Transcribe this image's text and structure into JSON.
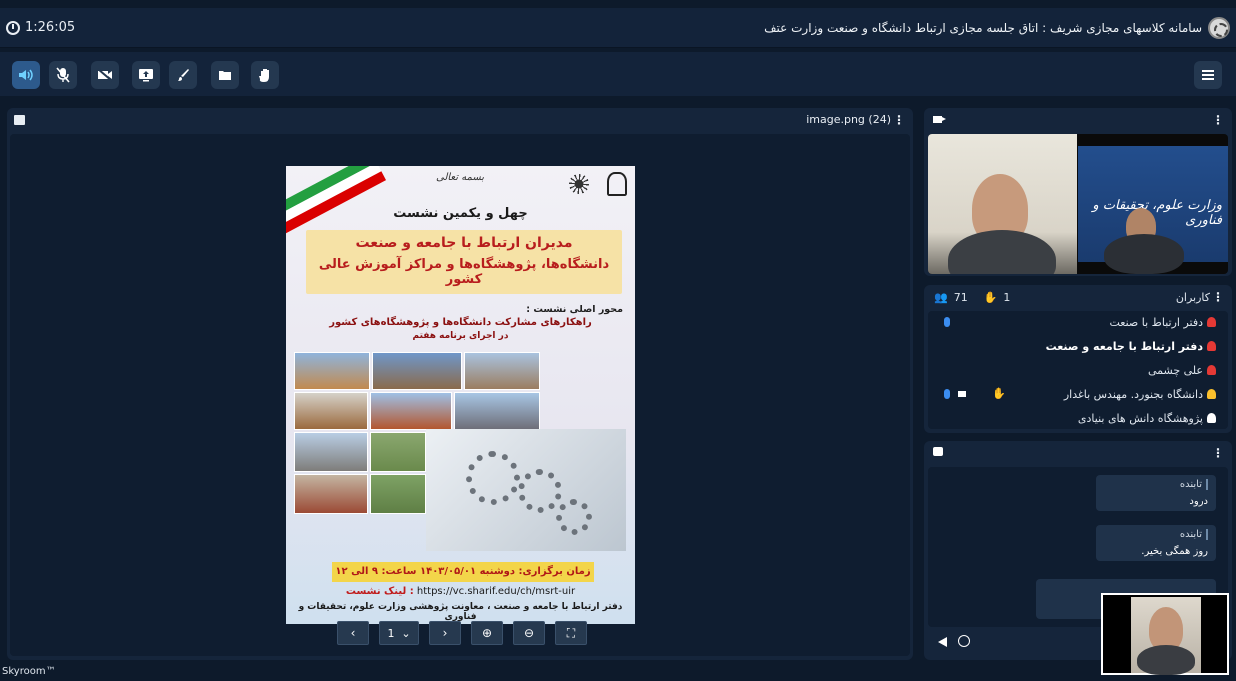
{
  "header": {
    "timer": "1:26:05",
    "title": "سامانه کلاسهای مجازی شریف : اتاق جلسه مجازی ارتباط دانشگاه و صنعت وزارت عتف"
  },
  "toolbar": {
    "buttons": [
      "speaker-icon",
      "mic-off-icon",
      "camera-off-icon",
      "share-screen-icon",
      "brush-icon",
      "folder-icon",
      "raise-hand-icon"
    ],
    "menu": "menu-icon"
  },
  "stage": {
    "file_name": "image.png (24)",
    "page_number": "1",
    "poster": {
      "bism": "بسمه تعالی",
      "heading": "چهل و یکمین نشست",
      "banner_line1": "مدیران ارتباط با جامعه و صنعت",
      "banner_line2": "دانشگاه‌ها، پژوهشگاه‌ها و مراکز آموزش عالی کشور",
      "axis_label": "محور اصلی نشست :",
      "axis_text1": "راهکارهای مشارکت دانشگاه‌ها و پژوهشگاه‌های کشور",
      "axis_text2": "در اجرای برنامه هفتم",
      "date": "زمان برگزاری: دوشنبه ۱۴۰۳/۰۵/۰۱ ساعت: ۹ الی ۱۲",
      "link_label": "لینک نشست :",
      "link_url": "https://vc.sharif.edu/ch/msrt-uir",
      "footer": "دفتر ارتباط با جامعه و صنعت ، معاونت پژوهشی وزارت علوم، تحقیقات و فناوری",
      "ministry_text": "وزارت علوم، تحقیقات و فناوری"
    }
  },
  "users": {
    "title": "کاربران",
    "count": "71",
    "hands": "1",
    "list": [
      {
        "name": "دفتر ارتباط با صنعت",
        "color": "#e53935",
        "bold": false
      },
      {
        "name": "دفتر ارتباط با جامعه و صنعت",
        "color": "#e53935",
        "bold": true
      },
      {
        "name": "علی چشمی",
        "color": "#e53935",
        "bold": false
      },
      {
        "name": "دانشگاه بجنورد. مهندس باغدار",
        "color": "#fbc02d",
        "bold": false
      },
      {
        "name": "پژوهشگاه دانش های بنیادی",
        "color": "#ffffff",
        "bold": false
      }
    ]
  },
  "chat": {
    "messages": [
      {
        "sender": "تابنده",
        "text": "درود"
      },
      {
        "sender": "تابنده",
        "text": "روز همگی بخیر."
      }
    ]
  },
  "footer": {
    "brand": "Skyroom™"
  }
}
